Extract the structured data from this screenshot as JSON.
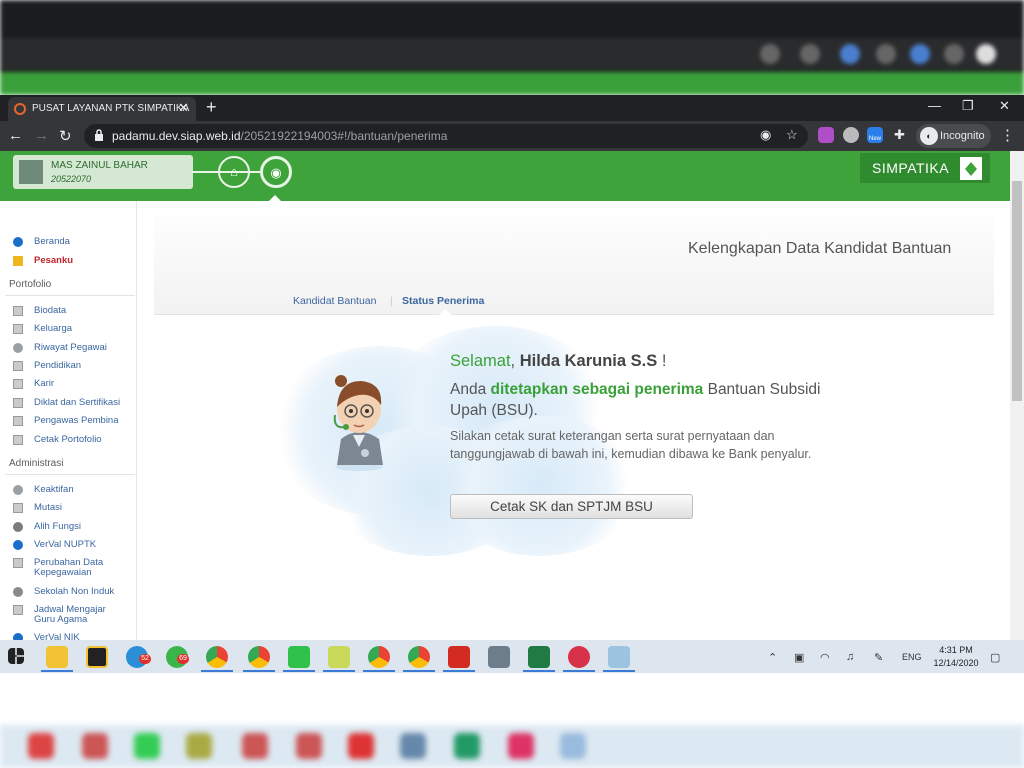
{
  "browser": {
    "tab_title": "PUSAT LAYANAN PTK SIMPATIKA",
    "tab_close": "✕",
    "new_tab": "+",
    "url_host": "padamu.dev.siap.web.id",
    "url_path": "/20521922194003#!/bantuan/penerima",
    "incognito_label": "Incognito",
    "ext_new_badge": "New"
  },
  "header": {
    "user_name": "MAS ZAINUL BAHAR",
    "user_id": "20522070",
    "brand": "SIMPATIKA"
  },
  "sidebar": {
    "top_items": [
      {
        "label": "Beranda",
        "icon": "info-icon"
      },
      {
        "label": "Pesanku",
        "icon": "message-alert-icon"
      }
    ],
    "portfolio_heading": "Portofolio",
    "portfolio_items": [
      {
        "label": "Biodata"
      },
      {
        "label": "Keluarga"
      },
      {
        "label": "Riwayat Pegawai"
      },
      {
        "label": "Pendidikan"
      },
      {
        "label": "Karir"
      },
      {
        "label": "Diklat dan Sertifikasi"
      },
      {
        "label": "Pengawas Pembina"
      },
      {
        "label": "Cetak Portofolio"
      }
    ],
    "admin_heading": "Administrasi",
    "admin_items": [
      {
        "label": "Keaktifan"
      },
      {
        "label": "Mutasi"
      },
      {
        "label": "Alih Fungsi"
      },
      {
        "label": "VerVal NUPTK"
      },
      {
        "label": "Perubahan Data"
      },
      {
        "label": "Kepegawaian"
      },
      {
        "label": "Sekolah Non Induk"
      },
      {
        "label": "Jadwal Mengajar"
      },
      {
        "label": "Guru Agama"
      },
      {
        "label": "VerVal NIK"
      }
    ]
  },
  "main": {
    "title": "Kelengkapan Data Kandidat Bantuan",
    "tabs": [
      "Kandidat Bantuan",
      "Status Penerima"
    ],
    "greeting_prefix": "Selamat",
    "greeting_sep": ", ",
    "recipient_name": "Hilda Karunia S.S",
    "greeting_suffix": " !",
    "msg_part1": "Anda ",
    "msg_bold": "ditetapkan sebagai penerima",
    "msg_part2": " Bantuan Subsidi Upah (BSU).",
    "instruction": "Silakan cetak surat keterangan serta surat pernyataan dan tanggungjawab di bawah ini, kemudian dibawa ke Bank penyalur.",
    "print_button": "Cetak SK dan SPTJM BSU"
  },
  "taskbar": {
    "badges": [
      "52",
      "69"
    ],
    "language": "ENG",
    "time": "4:31 PM",
    "date": "12/14/2020"
  },
  "colors": {
    "brand_green": "#3fa33c",
    "link_blue": "#3b66a0",
    "highlight_green": "#3aa13a"
  }
}
